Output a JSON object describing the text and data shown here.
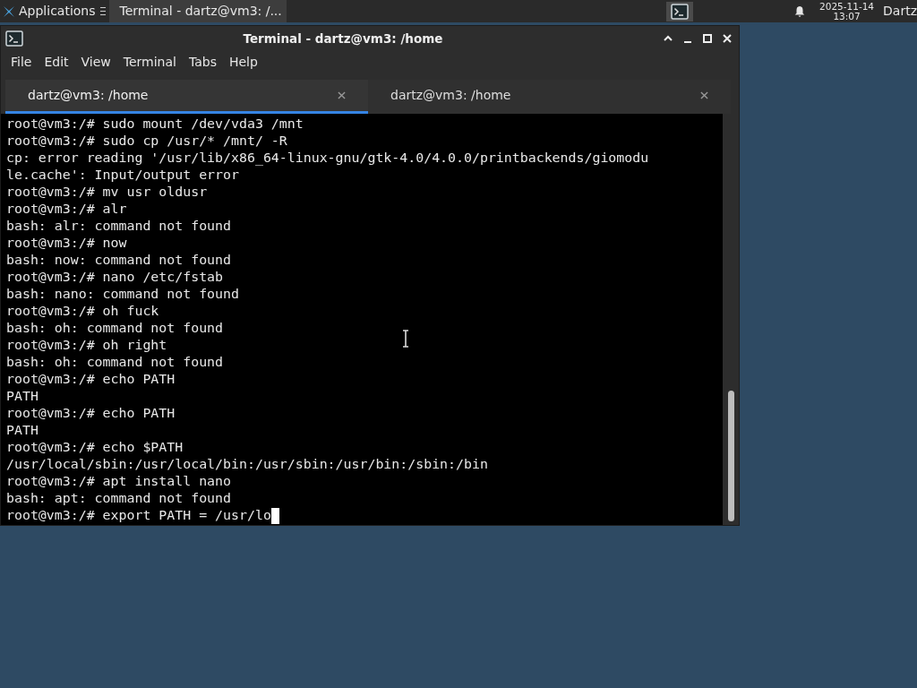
{
  "panel": {
    "applications": "Applications",
    "tasks": [
      {
        "label": "Terminal - dartz@vm3: /...",
        "selected": true
      }
    ],
    "clock": {
      "date": "2025-11-14",
      "time": "13:07"
    },
    "user": "Dartz"
  },
  "window": {
    "title": "Terminal - dartz@vm3: /home"
  },
  "menu": [
    "File",
    "Edit",
    "View",
    "Terminal",
    "Tabs",
    "Help"
  ],
  "tabs": [
    {
      "label": "dartz@vm3: /home",
      "selected": true
    },
    {
      "label": "dartz@vm3: /home",
      "selected": false
    }
  ],
  "terminal": {
    "lines": [
      "root@vm3:/# sudo mount /dev/vda3 /mnt",
      "root@vm3:/# sudo cp /usr/* /mnt/ -R",
      "cp: error reading '/usr/lib/x86_64-linux-gnu/gtk-4.0/4.0.0/printbackends/giomodu",
      "le.cache': Input/output error",
      "root@vm3:/# mv usr oldusr",
      "root@vm3:/# alr",
      "bash: alr: command not found",
      "root@vm3:/# now",
      "bash: now: command not found",
      "root@vm3:/# nano /etc/fstab",
      "bash: nano: command not found",
      "root@vm3:/# oh fuck",
      "bash: oh: command not found",
      "root@vm3:/# oh right",
      "bash: oh: command not found",
      "root@vm3:/# echo PATH",
      "PATH",
      "root@vm3:/# echo PATH",
      "PATH",
      "root@vm3:/# echo $PATH",
      "/usr/local/sbin:/usr/local/bin:/usr/sbin:/usr/bin:/sbin:/bin",
      "root@vm3:/# apt install nano",
      "bash: apt: command not found",
      "root@vm3:/# export PATH = /usr/lo"
    ]
  }
}
